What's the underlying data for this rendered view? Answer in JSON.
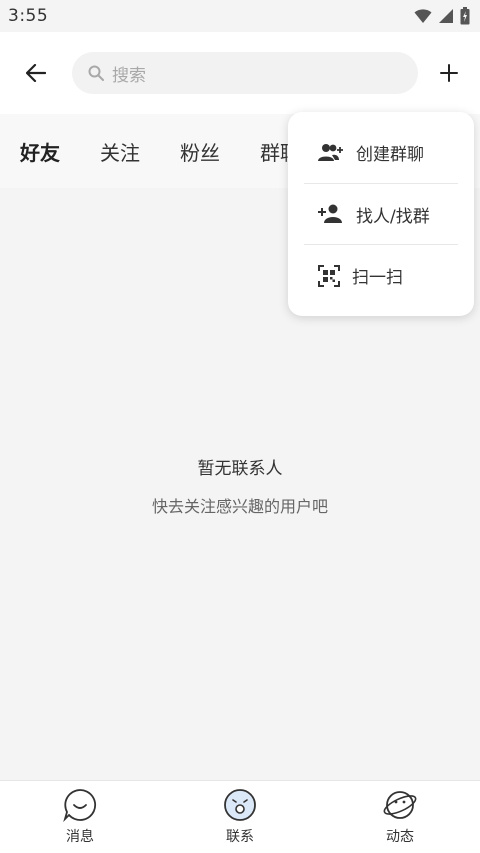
{
  "status_bar": {
    "time": "3:55"
  },
  "top_bar": {
    "search_placeholder": "搜索"
  },
  "tabs": [
    {
      "label": "好友",
      "active": true
    },
    {
      "label": "关注",
      "active": false
    },
    {
      "label": "粉丝",
      "active": false
    },
    {
      "label": "群聊",
      "active": false
    }
  ],
  "popup_menu": {
    "items": [
      {
        "label": "创建群聊",
        "icon": "group-add-icon"
      },
      {
        "label": "找人/找群",
        "icon": "person-add-icon"
      },
      {
        "label": "扫一扫",
        "icon": "qr-scan-icon"
      }
    ]
  },
  "empty_state": {
    "title": "暂无联系人",
    "subtitle": "快去关注感兴趣的用户吧"
  },
  "bottom_nav": {
    "items": [
      {
        "label": "消息",
        "icon": "message-icon"
      },
      {
        "label": "联系",
        "icon": "contacts-icon",
        "active": true
      },
      {
        "label": "动态",
        "icon": "feed-icon"
      }
    ]
  },
  "colors": {
    "background": "#f4f4f4",
    "surface": "#ffffff",
    "active_nav": "#3a7bd5"
  }
}
